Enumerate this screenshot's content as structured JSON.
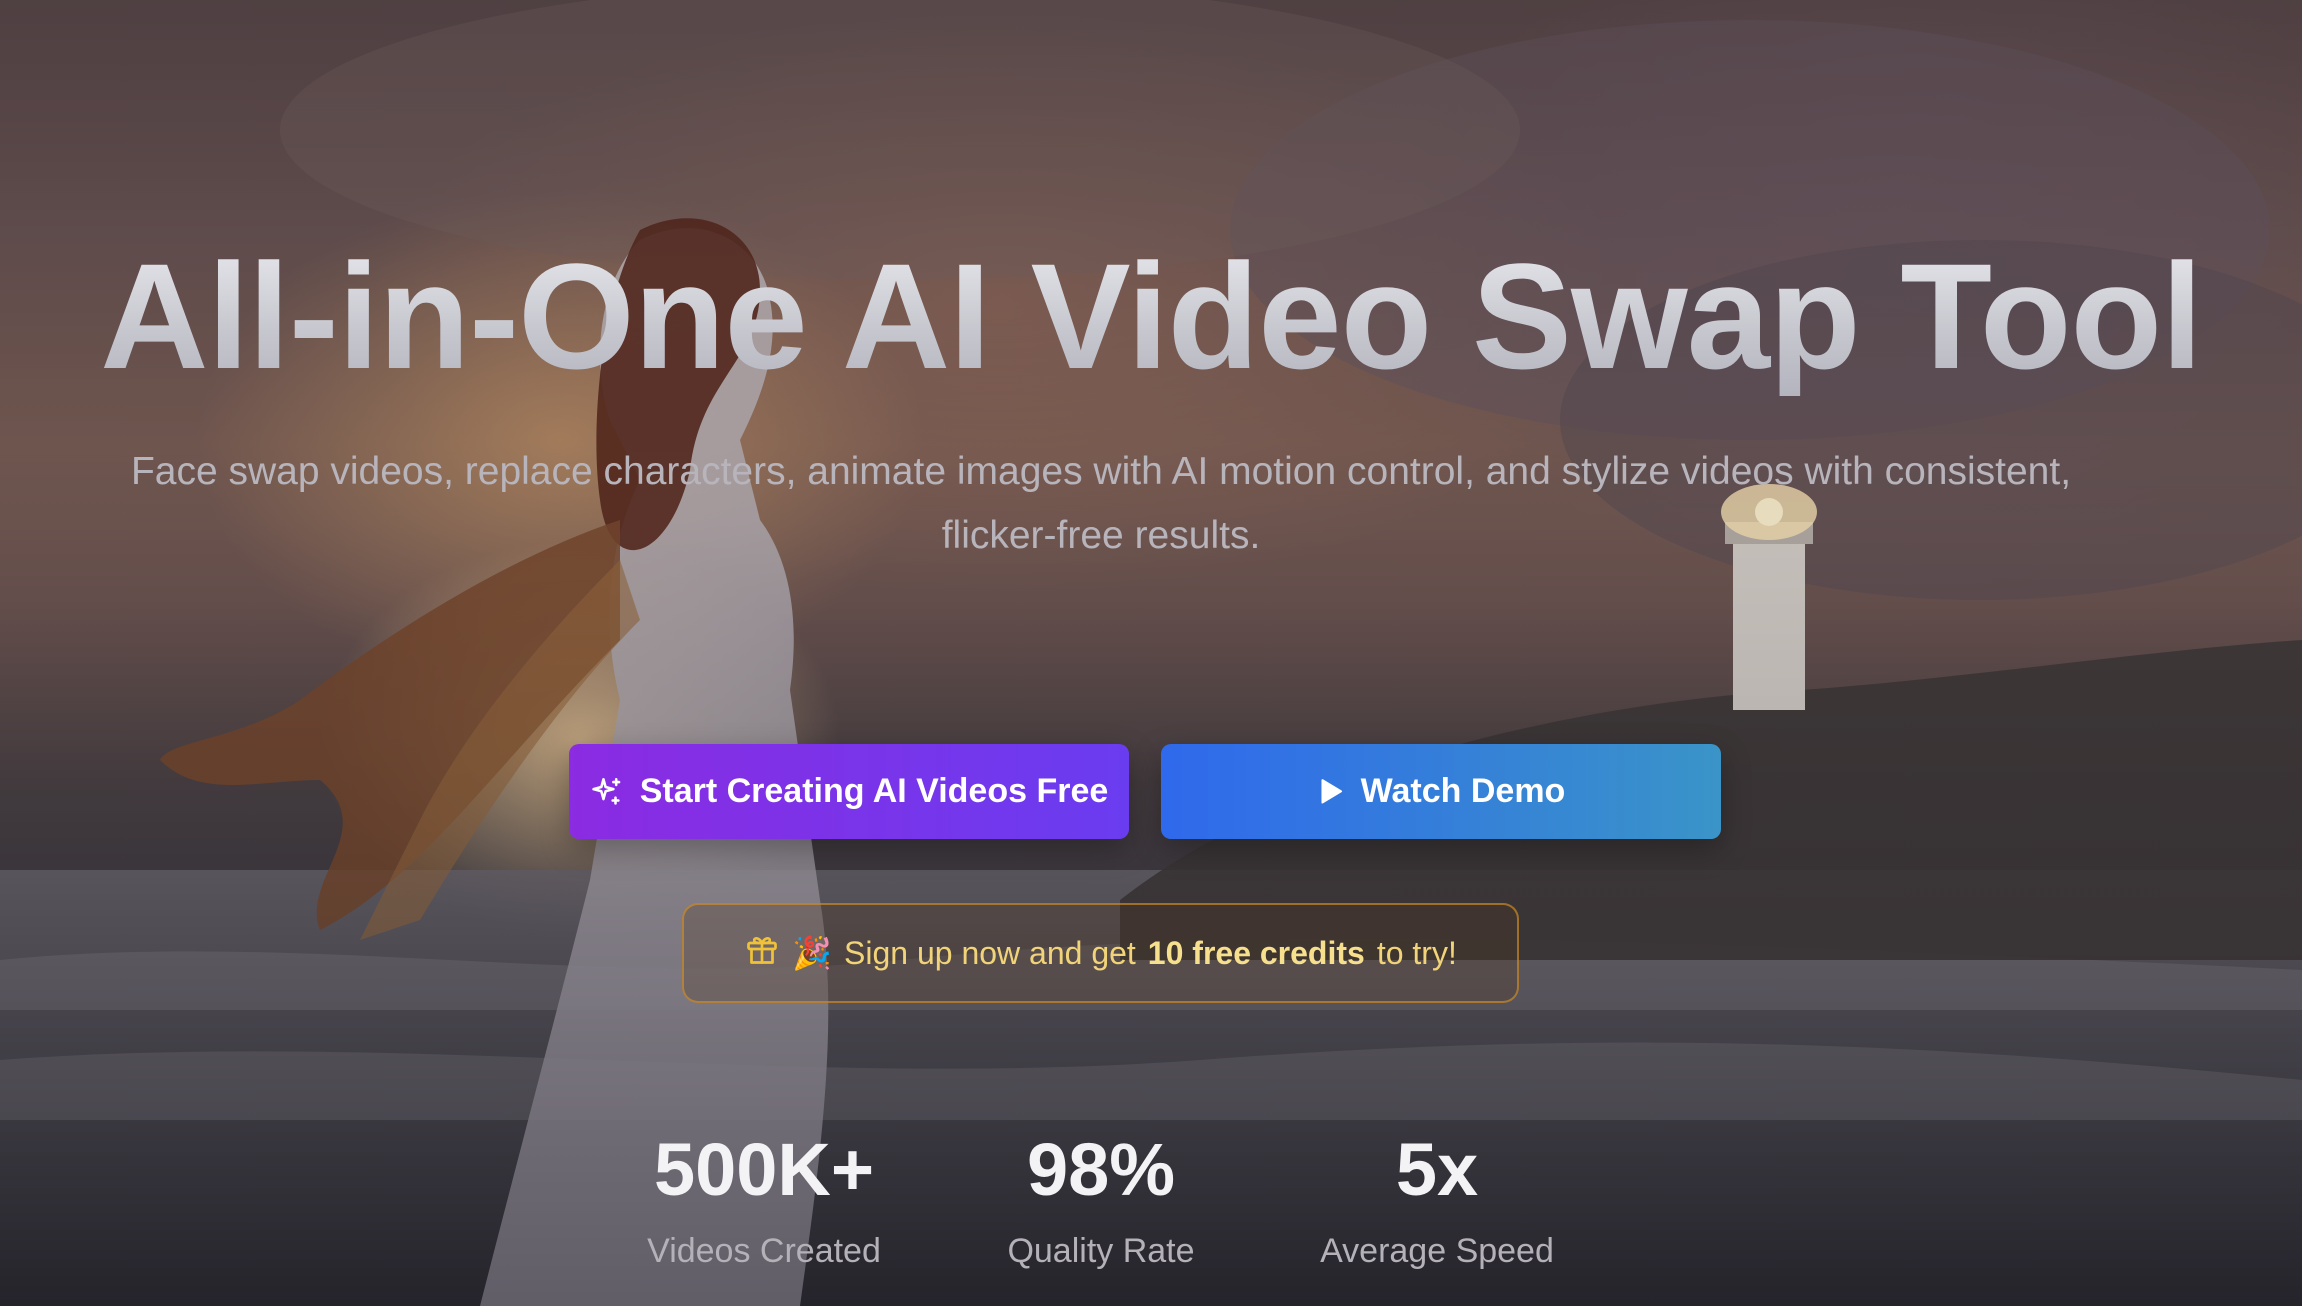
{
  "hero": {
    "headline": "All-in-One AI Video Swap Tool",
    "subtitle": "Face swap videos, replace characters, animate images with AI motion control, and stylize videos with consistent, flicker-free results."
  },
  "cta": {
    "primary": {
      "label": "Start Creating AI Videos Free",
      "icon": "sparkles-icon",
      "color_from": "#8b2be2",
      "color_to": "#6a3cf0"
    },
    "secondary": {
      "label": "Watch Demo",
      "icon": "play-icon",
      "color_from": "#2f69ec",
      "color_to": "#3a94c8"
    }
  },
  "promo": {
    "icon": "gift-icon",
    "emoji": "🎉",
    "text_before": "Sign up now and get",
    "highlight": "10 free credits",
    "text_after": "to try!",
    "color": "#f1d479"
  },
  "stats": [
    {
      "value": "500K+",
      "label": "Videos Created"
    },
    {
      "value": "98%",
      "label": "Quality Rate"
    },
    {
      "value": "5x",
      "label": "Average Speed"
    }
  ]
}
